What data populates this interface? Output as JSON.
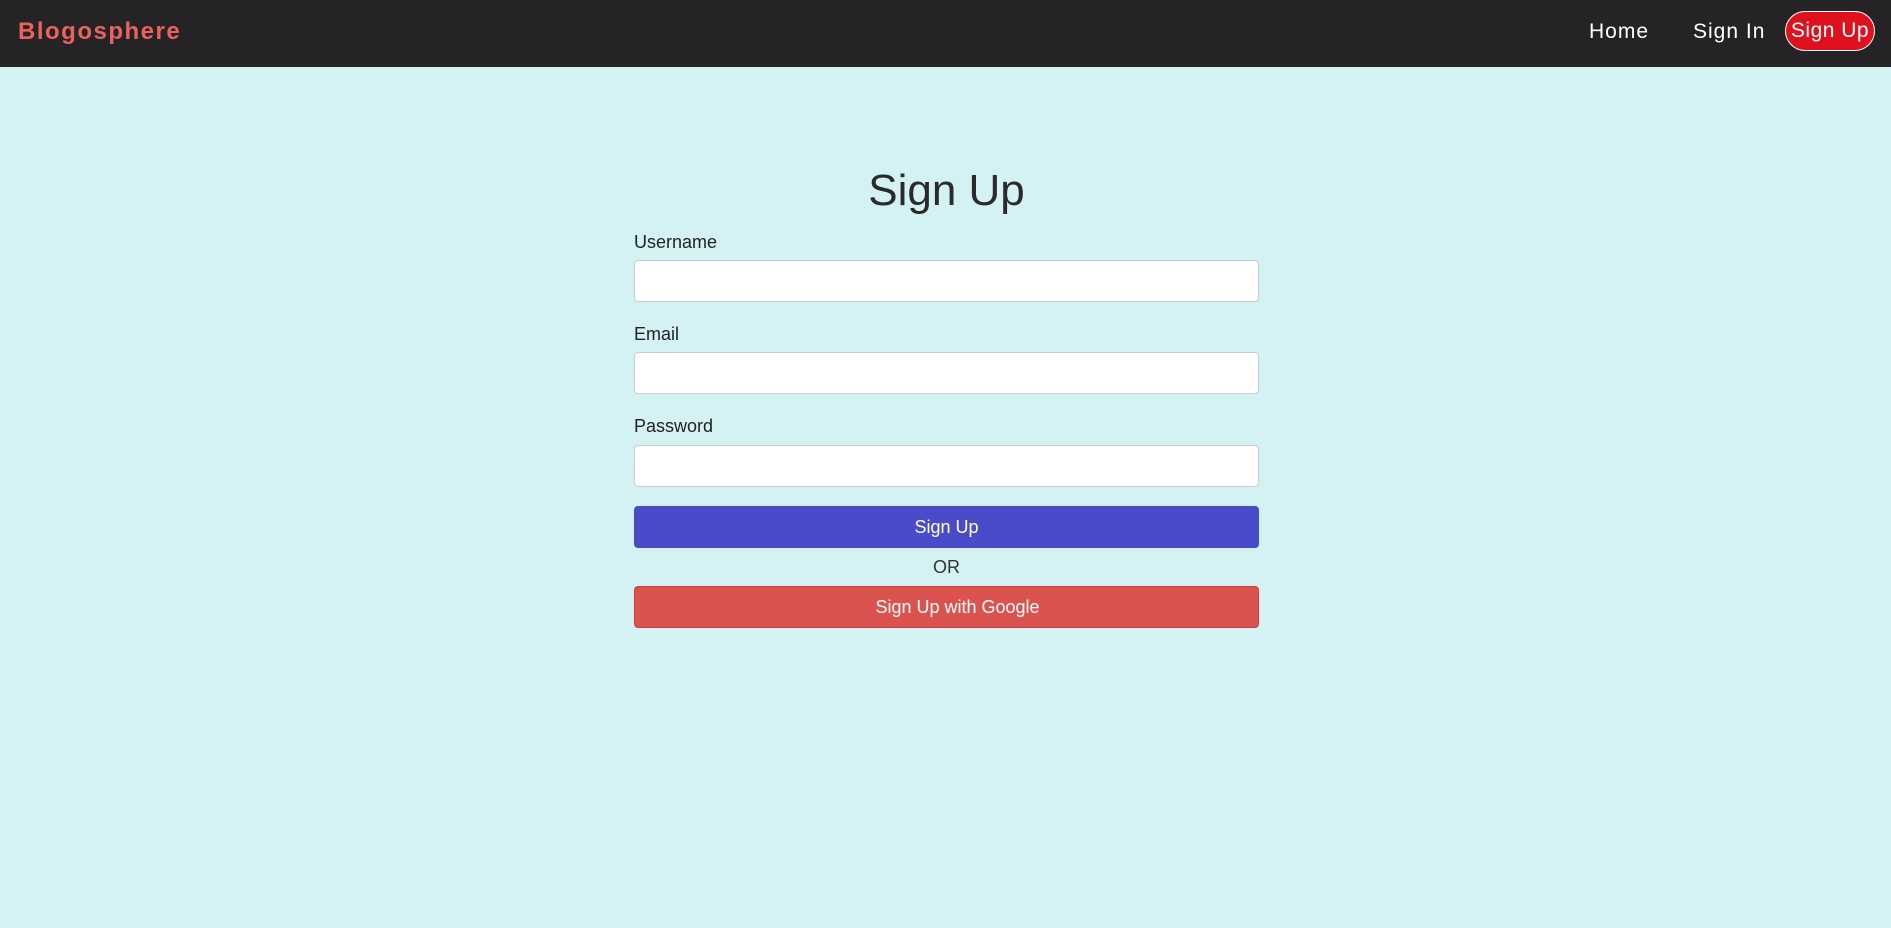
{
  "nav": {
    "brand": "Blogosphere",
    "links": [
      "Home",
      "Sign In"
    ],
    "cta": "Sign Up",
    "brand_color": "#e8635d",
    "cta_color": "#e0111e",
    "background": "#252325"
  },
  "form": {
    "title": "Sign Up",
    "fields": [
      {
        "label": "Username",
        "value": "",
        "placeholder": ""
      },
      {
        "label": "Email",
        "value": "",
        "placeholder": ""
      },
      {
        "label": "Password",
        "value": "",
        "placeholder": ""
      }
    ],
    "submit_label": "Sign Up",
    "separator": "OR",
    "google_label": "Sign Up with Google",
    "submit_color": "#4a4bc8",
    "google_color": "#db534f"
  },
  "page": {
    "background": "#d4f1f3"
  }
}
